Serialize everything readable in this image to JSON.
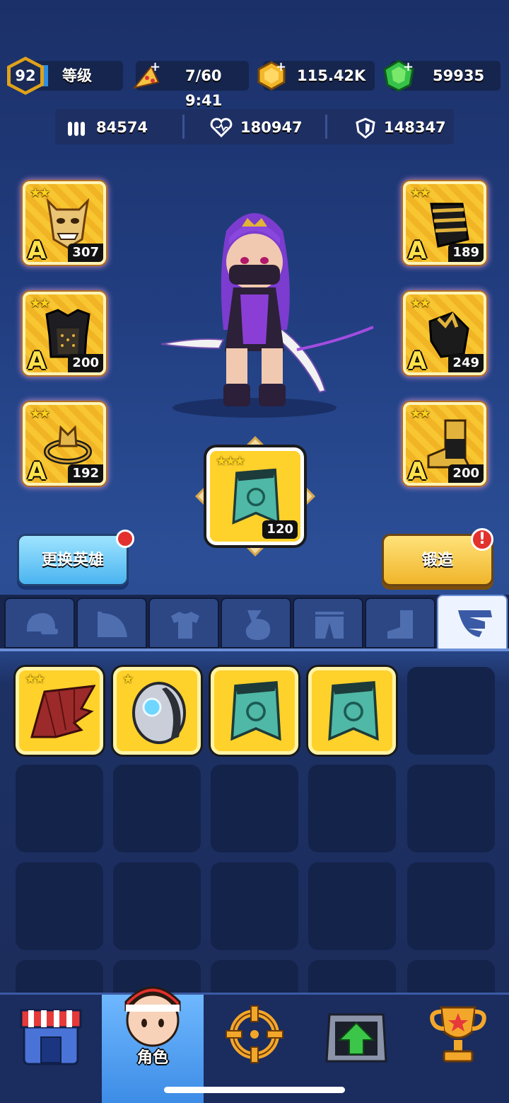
{
  "status": {
    "time": "9:41"
  },
  "header": {
    "level": "92",
    "level_label": "等级",
    "energy": "7/60",
    "coins": "115.42K",
    "gems": "59935"
  },
  "stats": {
    "attack": "84574",
    "health": "180947",
    "defense": "148347"
  },
  "equipment": {
    "left": [
      {
        "name": "oni-mask",
        "grade": "A",
        "stars": "★★",
        "level": "307"
      },
      {
        "name": "armor",
        "grade": "A",
        "stars": "★★",
        "level": "200"
      },
      {
        "name": "dragon-ring",
        "grade": "A",
        "stars": "★★",
        "level": "192"
      }
    ],
    "right": [
      {
        "name": "bracer",
        "grade": "A",
        "stars": "★★",
        "level": "189"
      },
      {
        "name": "gauntlet",
        "grade": "A",
        "stars": "★★",
        "level": "249"
      },
      {
        "name": "boots",
        "grade": "A",
        "stars": "★★",
        "level": "200"
      }
    ],
    "featured": {
      "name": "cape",
      "stars": "★★★",
      "level": "120"
    }
  },
  "buttons": {
    "swap_hero": "更换英雄",
    "forge": "锻造",
    "forge_alert": "!"
  },
  "tabs": [
    "helmet-icon",
    "shoulder-icon",
    "shirt-icon",
    "glove-icon",
    "pants-icon",
    "boot-icon",
    "wing-icon"
  ],
  "inventory": [
    {
      "name": "demon-wings",
      "stars": "★★"
    },
    {
      "name": "mech-orb",
      "stars": "★"
    },
    {
      "name": "cape",
      "stars": ""
    },
    {
      "name": "cape",
      "stars": ""
    }
  ],
  "nav": {
    "active_label": "角色"
  },
  "colors": {
    "gold": "#f7c631",
    "accent_blue": "#4ab4f0",
    "alert_red": "#e3312d"
  }
}
